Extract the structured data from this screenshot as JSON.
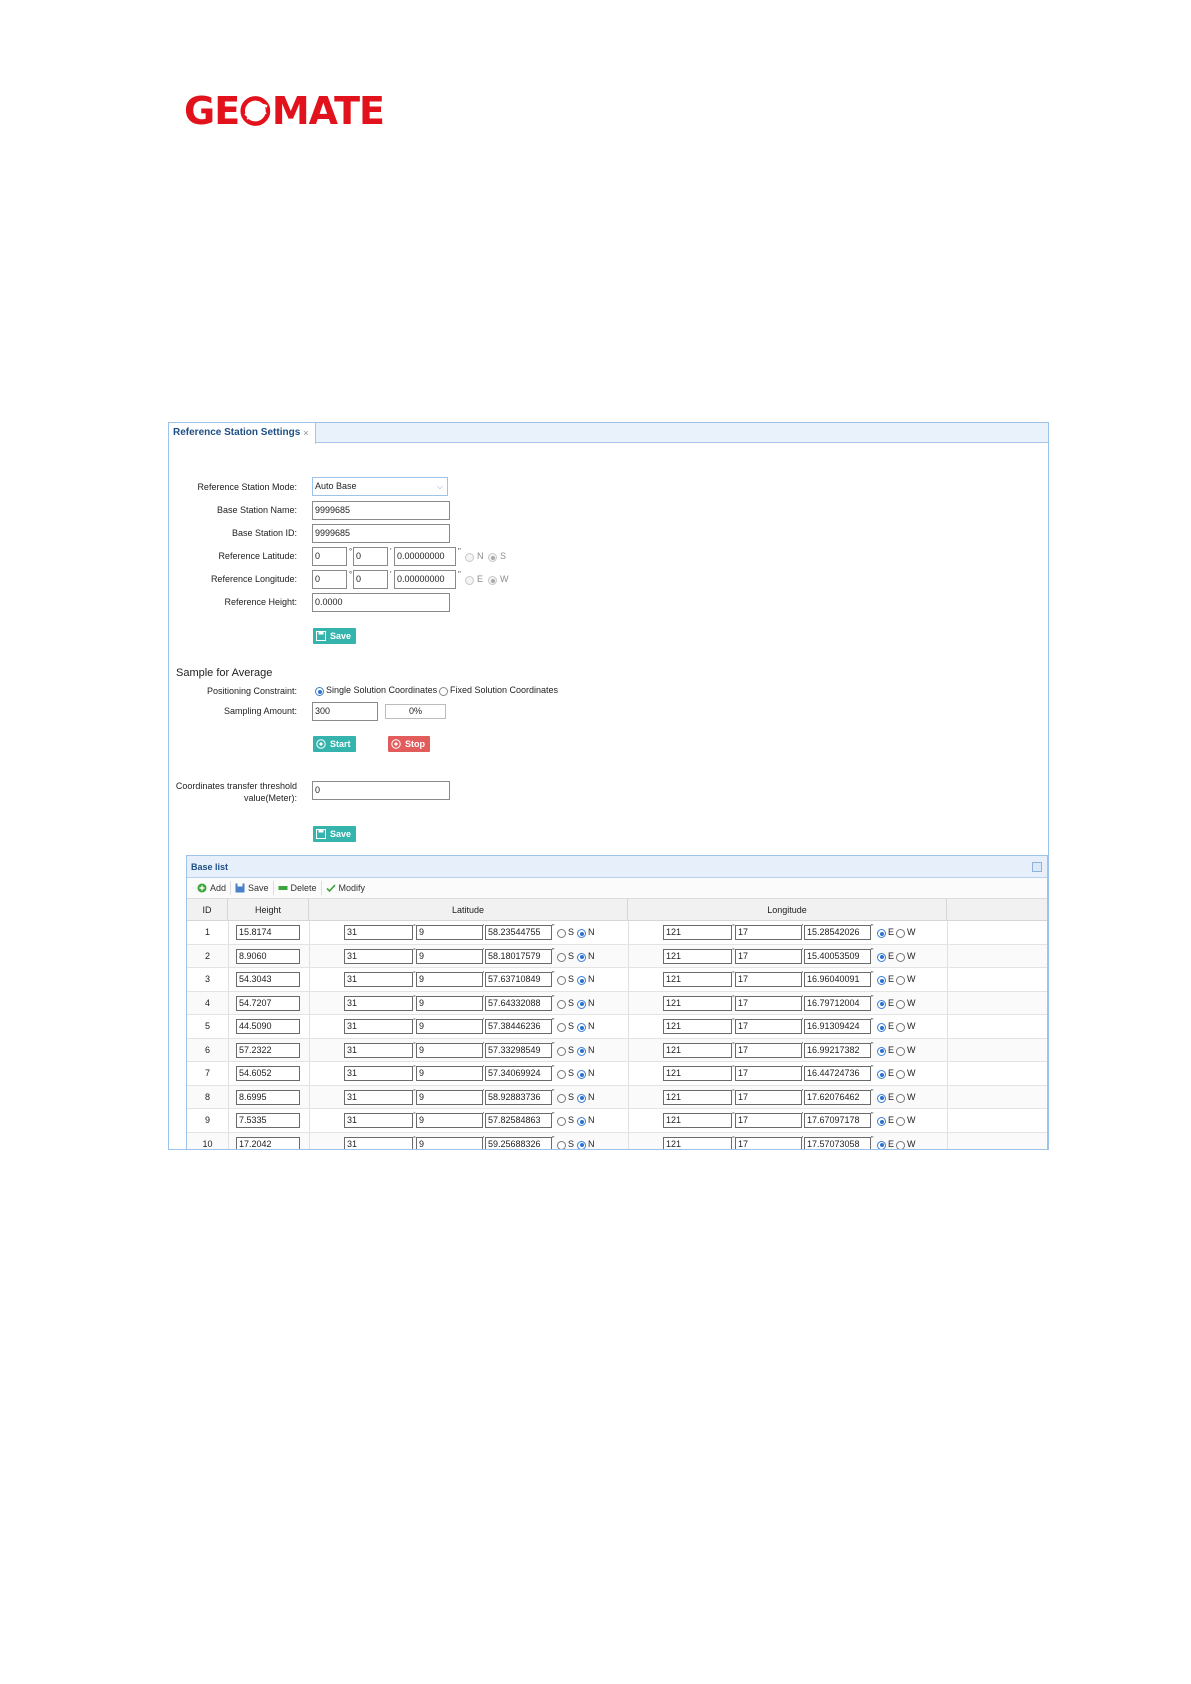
{
  "brand": {
    "logo_text_left": "GE",
    "logo_text_right": "MATE",
    "color": "#e1121b"
  },
  "tab": {
    "title": "Reference Station Settings",
    "close": "×"
  },
  "form": {
    "mode_label": "Reference Station Mode:",
    "mode_value": "Auto Base",
    "name_label": "Base Station Name:",
    "name_value": "9999685",
    "id_label": "Base Station ID:",
    "id_value": "9999685",
    "lat_label": "Reference Latitude:",
    "lat_deg": "0",
    "lat_min": "0",
    "lat_sec": "0.00000000",
    "lat_hemi_n": "N",
    "lat_hemi_s": "S",
    "lon_label": "Reference Longitude:",
    "lon_deg": "0",
    "lon_min": "0",
    "lon_sec": "0.00000000",
    "lon_hemi_e": "E",
    "lon_hemi_w": "W",
    "height_label": "Reference Height:",
    "height_value": "0.0000",
    "save_label": "Save"
  },
  "average": {
    "title": "Sample for Average",
    "constraint_label": "Positioning Constraint:",
    "opt_single": "Single Solution Coordinates",
    "opt_fixed": "Fixed Solution Coordinates",
    "amount_label": "Sampling Amount:",
    "amount_value": "300",
    "progress": "0%",
    "start_label": "Start",
    "stop_label": "Stop"
  },
  "threshold": {
    "label_line1": "Coordinates transfer threshold",
    "label_line2": "value(Meter):",
    "value": "0",
    "save_label": "Save"
  },
  "base_list": {
    "title": "Base list",
    "toolbar": {
      "add": "Add",
      "save": "Save",
      "delete": "Delete",
      "modify": "Modify"
    },
    "columns": {
      "id": "ID",
      "height": "Height",
      "latitude": "Latitude",
      "longitude": "Longitude"
    },
    "hemi": {
      "s": "S",
      "n": "N",
      "e": "E",
      "w": "W"
    },
    "rows": [
      {
        "id": "1",
        "height": "15.8174",
        "lat_deg": "31",
        "lat_min": "9",
        "lat_sec": "58.23544755",
        "lon_deg": "121",
        "lon_min": "17",
        "lon_sec": "15.28542026"
      },
      {
        "id": "2",
        "height": "8.9060",
        "lat_deg": "31",
        "lat_min": "9",
        "lat_sec": "58.18017579",
        "lon_deg": "121",
        "lon_min": "17",
        "lon_sec": "15.40053509"
      },
      {
        "id": "3",
        "height": "54.3043",
        "lat_deg": "31",
        "lat_min": "9",
        "lat_sec": "57.63710849",
        "lon_deg": "121",
        "lon_min": "17",
        "lon_sec": "16.96040091"
      },
      {
        "id": "4",
        "height": "54.7207",
        "lat_deg": "31",
        "lat_min": "9",
        "lat_sec": "57.64332088",
        "lon_deg": "121",
        "lon_min": "17",
        "lon_sec": "16.79712004"
      },
      {
        "id": "5",
        "height": "44.5090",
        "lat_deg": "31",
        "lat_min": "9",
        "lat_sec": "57.38446236",
        "lon_deg": "121",
        "lon_min": "17",
        "lon_sec": "16.91309424"
      },
      {
        "id": "6",
        "height": "57.2322",
        "lat_deg": "31",
        "lat_min": "9",
        "lat_sec": "57.33298549",
        "lon_deg": "121",
        "lon_min": "17",
        "lon_sec": "16.99217382"
      },
      {
        "id": "7",
        "height": "54.6052",
        "lat_deg": "31",
        "lat_min": "9",
        "lat_sec": "57.34069924",
        "lon_deg": "121",
        "lon_min": "17",
        "lon_sec": "16.44724736"
      },
      {
        "id": "8",
        "height": "8.6995",
        "lat_deg": "31",
        "lat_min": "9",
        "lat_sec": "58.92883736",
        "lon_deg": "121",
        "lon_min": "17",
        "lon_sec": "17.62076462"
      },
      {
        "id": "9",
        "height": "7.5335",
        "lat_deg": "31",
        "lat_min": "9",
        "lat_sec": "57.82584863",
        "lon_deg": "121",
        "lon_min": "17",
        "lon_sec": "17.67097178"
      },
      {
        "id": "10",
        "height": "17.2042",
        "lat_deg": "31",
        "lat_min": "9",
        "lat_sec": "59.25688326",
        "lon_deg": "121",
        "lon_min": "17",
        "lon_sec": "17.57073058"
      }
    ]
  }
}
